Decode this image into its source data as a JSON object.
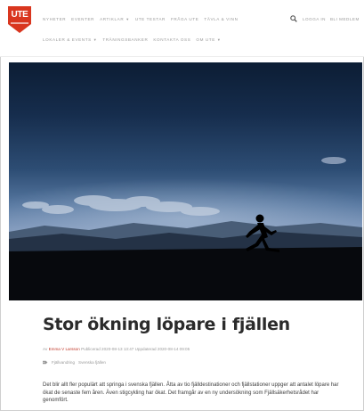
{
  "header": {
    "logo_text": "UTE",
    "nav_row1": [
      {
        "label": "Nyheter",
        "has_caret": false
      },
      {
        "label": "Eventer",
        "has_caret": false
      },
      {
        "label": "Artiklar",
        "has_caret": true
      },
      {
        "label": "UTE Testar",
        "has_caret": false
      },
      {
        "label": "Fråga UTE",
        "has_caret": false
      },
      {
        "label": "Tävla & Vinn",
        "has_caret": false
      }
    ],
    "nav_row2": [
      {
        "label": "Lokaler & Events",
        "has_caret": true
      },
      {
        "label": "Träningsbanker",
        "has_caret": false
      },
      {
        "label": "Kontakta oss",
        "has_caret": false
      },
      {
        "label": "Om UTE",
        "has_caret": true
      }
    ],
    "top_links": [
      "Logga in",
      "Bli medlem"
    ]
  },
  "colors": {
    "brand": "#d9361f",
    "title": "#2b2b2b",
    "meta": "#9b9b9b",
    "link": "#c0392b"
  },
  "article": {
    "title": "Stor ökning löpare i fjällen",
    "byline_prefix": "Av ",
    "author": "Emma V Larsson",
    "published": " Publicerad 2020-08-13 13:47",
    "updated": " Uppdaterad 2020-08-14 09:05",
    "tags": [
      "Fjällvandring",
      "Svenska fjällen"
    ],
    "body": "Det blir allt fler populärt att springa i svenska fjällen. Åtta av tio fjälldestinationer och fjällstationer uppger att antalet löpare har ökat de senaste fem åren. Även stigcykling har ökat. Det framgår av en ny undersökning som Fjällsäkerhetsrådet har genomfört."
  }
}
